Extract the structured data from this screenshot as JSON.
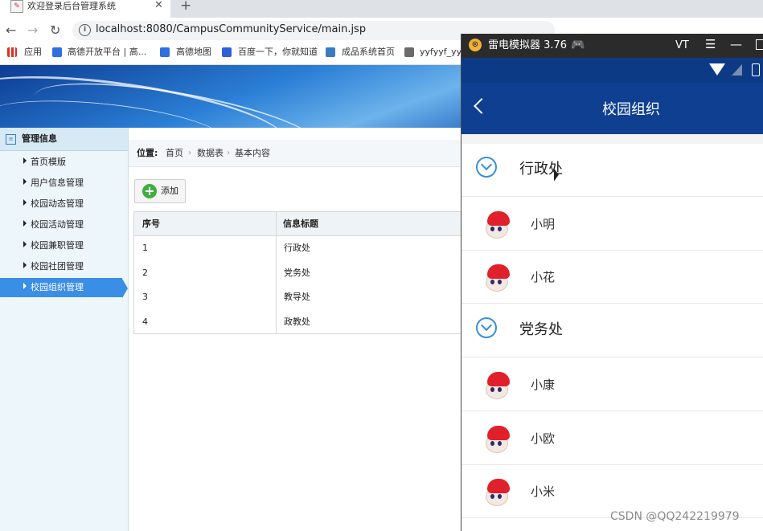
{
  "browser": {
    "tab_title": "欢迎登录后台管理系统",
    "favicon": "✎",
    "close_glyph": "✕",
    "new_tab_glyph": "+",
    "back_glyph": "←",
    "forward_glyph": "→",
    "reload_glyph": "↻",
    "url": "localhost:8080/CampusCommunityService/main.jsp"
  },
  "bookmarks": [
    {
      "label": "应用",
      "icon": "apps-grid-icon",
      "color": "#d93025"
    },
    {
      "label": "高德开放平台 | 高...",
      "icon": "amap-icon",
      "color": "#2f6fe0"
    },
    {
      "label": "高德地图",
      "icon": "amap-icon",
      "color": "#2f6fe0"
    },
    {
      "label": "百度一下，你就知道",
      "icon": "baidu-paw-icon",
      "color": "#3060d8"
    },
    {
      "label": "成品系统首页",
      "icon": "home-icon",
      "color": "#3a7cc2"
    },
    {
      "label": "yyfyyf_yyf",
      "icon": "fish-icon",
      "color": "#6a6a6a"
    }
  ],
  "sidebar": {
    "header": "管理信息",
    "items": [
      {
        "label": "首页模版",
        "active": false
      },
      {
        "label": "用户信息管理",
        "active": false
      },
      {
        "label": "校园动态管理",
        "active": false
      },
      {
        "label": "校园活动管理",
        "active": false
      },
      {
        "label": "校园兼职管理",
        "active": false
      },
      {
        "label": "校园社团管理",
        "active": false
      },
      {
        "label": "校园组织管理",
        "active": true
      }
    ]
  },
  "breadcrumb": {
    "label": "位置:",
    "items": [
      "首页",
      "数据表",
      "基本内容"
    ],
    "separator": "›"
  },
  "toolbar": {
    "add_label": "添加"
  },
  "table": {
    "headers": [
      "序号",
      "信息标题"
    ],
    "rows": [
      [
        "1",
        "行政处"
      ],
      [
        "2",
        "党务处"
      ],
      [
        "3",
        "教导处"
      ],
      [
        "4",
        "政教处"
      ]
    ]
  },
  "emulator": {
    "title": "雷电模拟器 3.76",
    "logo": "⊙",
    "gamepad_glyph": "🎮",
    "vt_label": "VT",
    "menu_glyph": "☰",
    "minimize_glyph": "—",
    "app_title": "校园组织",
    "list": [
      {
        "type": "group",
        "label": "行政处"
      },
      {
        "type": "person",
        "label": "小明"
      },
      {
        "type": "person",
        "label": "小花"
      },
      {
        "type": "group",
        "label": "党务处"
      },
      {
        "type": "person",
        "label": "小康"
      },
      {
        "type": "person",
        "label": "小欧"
      },
      {
        "type": "person",
        "label": "小米"
      }
    ],
    "accent": "#0e3f91"
  },
  "watermark": "CSDN @QQ242219979"
}
